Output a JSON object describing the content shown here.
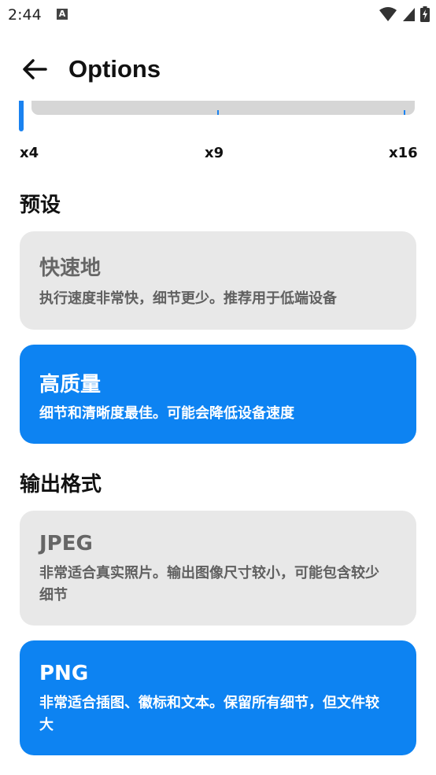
{
  "status_bar": {
    "time": "2:44",
    "notification_icon": "a-letter-icon",
    "icons": [
      "wifi-icon",
      "signal-icon",
      "battery-charging-icon"
    ]
  },
  "app_bar": {
    "title": "Options",
    "back_icon": "arrow-left-icon"
  },
  "scale_slider": {
    "tick_labels": [
      "x4",
      "x9",
      "x16"
    ],
    "selected_label": "x4",
    "accent_color": "#1a82f0",
    "track_color": "#d6d6d6"
  },
  "preset": {
    "heading": "预设",
    "options": [
      {
        "title": "快速地",
        "description": "执行速度非常快，细节更少。推荐用于低端设备",
        "selected": false
      },
      {
        "title": "高质量",
        "description": "细节和清晰度最佳。可能会降低设备速度",
        "selected": true
      }
    ]
  },
  "output_format": {
    "heading": "输出格式",
    "options": [
      {
        "title": "JPEG",
        "description": "非常适合真实照片。输出图像尺寸较小，可能包含较少细节",
        "selected": false
      },
      {
        "title": "PNG",
        "description": "非常适合插图、徽标和文本。保留所有细节，但文件较大",
        "selected": true
      }
    ]
  },
  "colors": {
    "selected_card": "#0d83f2",
    "unselected_card": "#e8e8e8"
  }
}
